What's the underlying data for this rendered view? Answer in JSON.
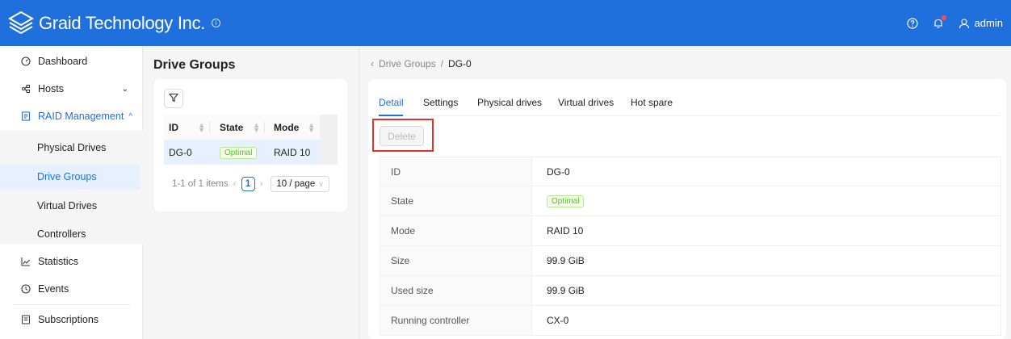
{
  "header": {
    "company_name": "Graid Technology Inc.",
    "info_icon": "info-icon",
    "help_icon": "question-circle-icon",
    "notification_icon": "bell-icon",
    "user_icon": "user-icon",
    "username": "admin",
    "brand_color": "#1f6fdd"
  },
  "sidebar": {
    "dashboard": "Dashboard",
    "hosts": "Hosts",
    "raid_management": "RAID Management",
    "sub_items": [
      "Physical Drives",
      "Drive Groups",
      "Virtual Drives",
      "Controllers"
    ],
    "statistics": "Statistics",
    "events": "Events",
    "subscriptions": "Subscriptions"
  },
  "drive_groups": {
    "title": "Drive Groups",
    "columns": [
      "ID",
      "State",
      "Mode"
    ],
    "rows": [
      {
        "id": "DG-0",
        "state": "Optimal",
        "mode": "RAID 10"
      }
    ],
    "pagination": {
      "summary": "1-1 of 1 items",
      "current_page": "1",
      "page_size": "10 / page"
    }
  },
  "breadcrumb": {
    "parent": "Drive Groups",
    "separator": "/",
    "current": "DG-0"
  },
  "detail": {
    "tabs": [
      "Detail",
      "Settings",
      "Physical drives",
      "Virtual drives",
      "Hot spare"
    ],
    "active_tab": "Detail",
    "delete_label": "Delete",
    "fields": [
      {
        "label": "ID",
        "value": "DG-0"
      },
      {
        "label": "State",
        "value": "Optimal"
      },
      {
        "label": "Mode",
        "value": "RAID 10"
      },
      {
        "label": "Size",
        "value": "99.9 GiB"
      },
      {
        "label": "Used size",
        "value": "99.9 GiB"
      },
      {
        "label": "Running controller",
        "value": "CX-0"
      }
    ]
  }
}
